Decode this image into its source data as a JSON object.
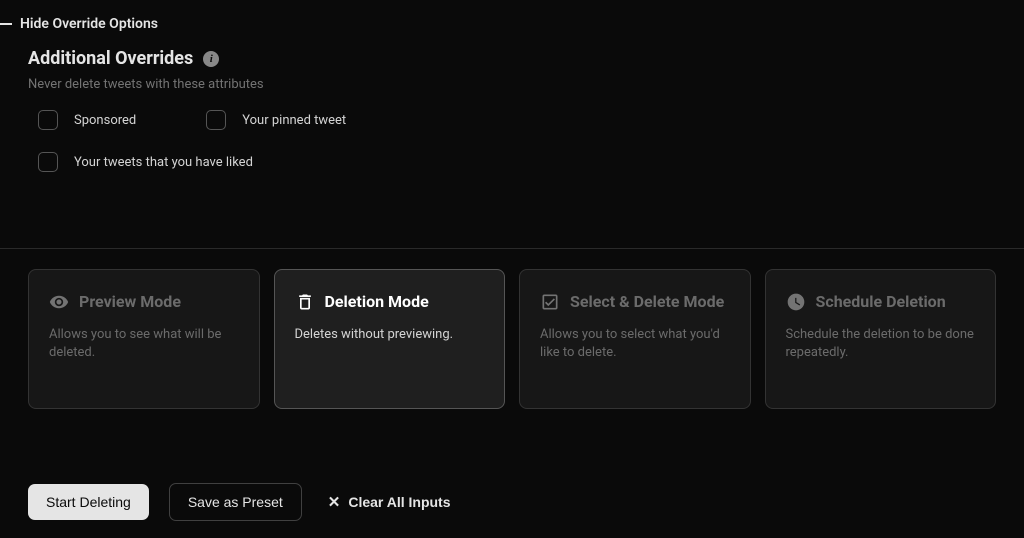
{
  "header": {
    "toggle_label": "Hide Override Options"
  },
  "overrides": {
    "title": "Additional Overrides",
    "subtitle": "Never delete tweets with these attributes",
    "items": [
      {
        "label": "Sponsored"
      },
      {
        "label": "Your pinned tweet"
      },
      {
        "label": "Your tweets that you have liked"
      }
    ]
  },
  "modes": [
    {
      "title": "Preview Mode",
      "desc": "Allows you to see what will be deleted."
    },
    {
      "title": "Deletion Mode",
      "desc": "Deletes without previewing."
    },
    {
      "title": "Select & Delete Mode",
      "desc": "Allows you to select what you'd like to delete."
    },
    {
      "title": "Schedule Deletion",
      "desc": "Schedule the deletion to be done repeatedly."
    }
  ],
  "actions": {
    "start": "Start Deleting",
    "save": "Save as Preset",
    "clear": "Clear All Inputs"
  }
}
